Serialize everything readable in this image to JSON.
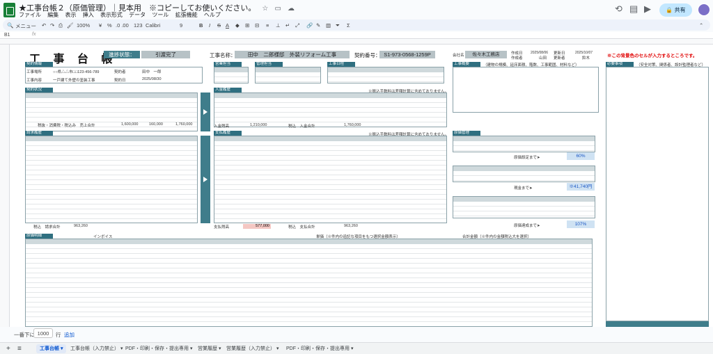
{
  "window": {
    "doc_title": "★工事台帳２（原価管理）｜見本用　※コピーしてお使いください。",
    "menus": [
      "ファイル",
      "編集",
      "表示",
      "挿入",
      "表示形式",
      "データ",
      "ツール",
      "拡張機能",
      "ヘルプ"
    ],
    "share_label": "共有"
  },
  "toolbar": {
    "search": "メニュー",
    "zoom": "100%",
    "currency": "¥",
    "percent": "%",
    "decimals": ".0  .00",
    "number_format": "123",
    "font": "Calibri",
    "font_size": "9",
    "bold": "B",
    "italic": "I",
    "strike": "S",
    "underline_a": "A"
  },
  "formula_bar": {
    "cell_ref": "B1",
    "fx": "fx"
  },
  "sheet": {
    "title": "工 事 台 帳",
    "status_label": "進捗状態：",
    "status_value": "引渡完了",
    "project_label": "工事名称：",
    "project_value": "田中　二郎様邸　外装リフォーム工事",
    "contract_no_label": "契約番号：",
    "contract_no_value": "S1-973-0568-1259P",
    "company_label": "会社名",
    "company_value": "佐々木工務店",
    "created_label": "作成日",
    "created_value": "2025/08/06",
    "author_label": "作成者",
    "author_value": "山田",
    "updated_label": "更新日",
    "updated_value": "2025/10/07",
    "updater_label": "更新者",
    "updater_value": "鈴木",
    "warning": "※この背景色のセルが入力するところです。",
    "sections": {
      "contract": "契約情報",
      "sales": "営業担当",
      "manager": "管理担当",
      "schedule": "工事日程",
      "contract_status": "契約状況",
      "deposit": "入金履歴",
      "invoice": "請求履歴",
      "payment": "支払履歴",
      "construction": "工事概要",
      "budget": "原価管理",
      "notes": "必要事項",
      "detail": "原価明細"
    },
    "contract_rows": [
      {
        "label": "工事場所",
        "value": "○○県△△市□□123-456-789"
      },
      {
        "label": "工事内容",
        "value": "一戸建て外壁の塗装工事"
      }
    ],
    "contract_side": [
      {
        "label": "契約者",
        "value": "田中　一郎"
      },
      {
        "label": "契約日",
        "value": "2025/08/30"
      }
    ],
    "construction_note": "（建物の規模、延床面積、階数、工事範囲、材料など）",
    "notes_note": "（安全対策、関係者、設計監理者など）",
    "deposit_note": "※振込手数料は差額計算に含めておりません。",
    "payment_note": "※振込手数料は差額計算に含めておりません。",
    "contract_totals_label": "税抜・消費税・税込み　売上合計",
    "contract_totals": [
      "1,600,000",
      "160,000",
      "1,760,000"
    ],
    "deposit_total_label": "入金残高",
    "deposit_total": "1,210,000",
    "deposit_sum_label": "税込　入金合計",
    "deposit_sum": "1,760,000",
    "invoice_total_label": "税込　請求合計",
    "invoice_total": "963,260",
    "payment_total_label": "支払残高",
    "payment_total": "577,000",
    "payment_sum_label": "税込　支払合計",
    "payment_sum": "963,260",
    "profit_set_label": "原価設定まで➤",
    "profit_set_value": "60%",
    "profit_achieved_label": "原価達成まで➤",
    "profit_achieved_value": "107%",
    "profit_amount_label": "現金まで➤",
    "profit_amount_value": "※41,740円",
    "detail_header": "合計金額（※件内の金額税込大を選択）",
    "detail_header2": "単価（※件内の追記な項目をもつ選択金額表示）",
    "invoice_heading": "インボイス"
  },
  "bottom": {
    "rows_label": "一番下に",
    "rows_value": "1000",
    "rows_suffix": "行",
    "add_label": "追加"
  },
  "tabs": [
    "工事台帳",
    "工事台帳（入力禁止）",
    "PDF・印刷・保存・提出専用",
    "営業履歴",
    "営業履歴（入力禁止）",
    "PDF・印刷・保存・提出専用"
  ],
  "colors": {
    "teal": "#3f7d8b",
    "accent_blue": "#0b57d0",
    "warning_red": "#e00000"
  }
}
